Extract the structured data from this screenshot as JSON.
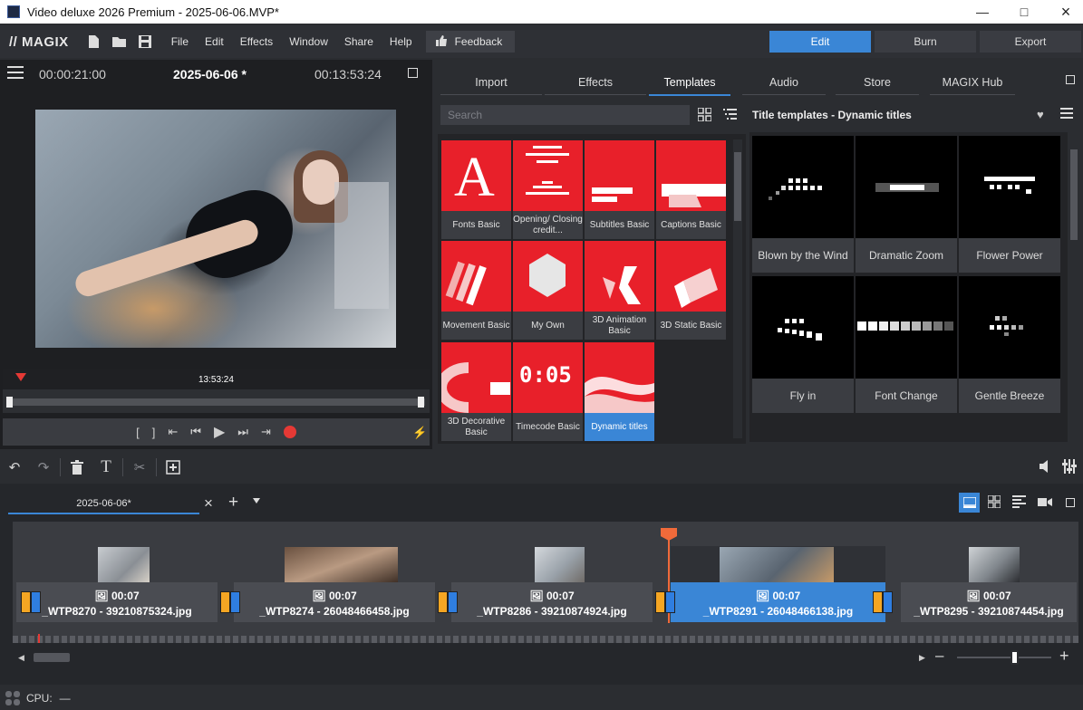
{
  "window": {
    "title": "Video deluxe 2026 Premium - 2025-06-06.MVP*"
  },
  "menubar": {
    "logo": "MAGIX",
    "items": [
      "File",
      "Edit",
      "Effects",
      "Window",
      "Share",
      "Help"
    ],
    "feedback_label": "Feedback",
    "modes": [
      "Edit",
      "Burn",
      "Export"
    ],
    "active_mode": "Edit"
  },
  "preview": {
    "time_left": "00:00:21:00",
    "project_title": "2025-06-06 *",
    "time_right": "00:13:53:24",
    "playhead_time": "13:53:24",
    "transport": {
      "in_mark": "[",
      "out_mark": "]"
    }
  },
  "media_pool": {
    "tabs": [
      "Import",
      "Effects",
      "Templates",
      "Audio",
      "Store",
      "MAGIX Hub"
    ],
    "active_tab": "Templates",
    "search_placeholder": "Search",
    "categories": [
      {
        "label": "Fonts Basic",
        "glyph": "A"
      },
      {
        "label": "Opening/ Closing credit...",
        "glyph": ""
      },
      {
        "label": "Subtitles Basic",
        "glyph": ""
      },
      {
        "label": "Captions Basic",
        "glyph": ""
      },
      {
        "label": "Movement Basic",
        "glyph": ""
      },
      {
        "label": "My Own",
        "glyph": ""
      },
      {
        "label": "3D Animation Basic",
        "glyph": ""
      },
      {
        "label": "3D Static Basic",
        "glyph": ""
      },
      {
        "label": "3D Decorative Basic",
        "glyph": ""
      },
      {
        "label": "Timecode Basic",
        "glyph": "0:05"
      },
      {
        "label": "Dynamic titles",
        "glyph": ""
      }
    ],
    "selected_category": "Dynamic titles",
    "templates_header": "Title templates - Dynamic titles",
    "templates": [
      {
        "label": "Blown by the Wind"
      },
      {
        "label": "Dramatic Zoom"
      },
      {
        "label": "Flower Power"
      },
      {
        "label": "Fly in"
      },
      {
        "label": "Font Change"
      },
      {
        "label": "Gentle Breeze"
      }
    ]
  },
  "timeline": {
    "tab_label": "2025-06-06*",
    "clips": [
      {
        "duration": "00:07",
        "name": "_WTP8270 - 39210875324.jpg"
      },
      {
        "duration": "00:07",
        "name": "_WTP8274 - 26048466458.jpg"
      },
      {
        "duration": "00:07",
        "name": "_WTP8286 - 39210874924.jpg"
      },
      {
        "duration": "00:07",
        "name": "_WTP8291 - 26048466138.jpg"
      },
      {
        "duration": "00:07",
        "name": "_WTP8295 - 39210874454.jpg"
      }
    ],
    "selected_clip_index": 3
  },
  "status": {
    "cpu_label": "CPU:",
    "cpu_value": "—"
  },
  "colors": {
    "accent": "#3a86d6",
    "template_red": "#e8202a",
    "marker_orange": "#f5a623",
    "record_red": "#e53935"
  }
}
